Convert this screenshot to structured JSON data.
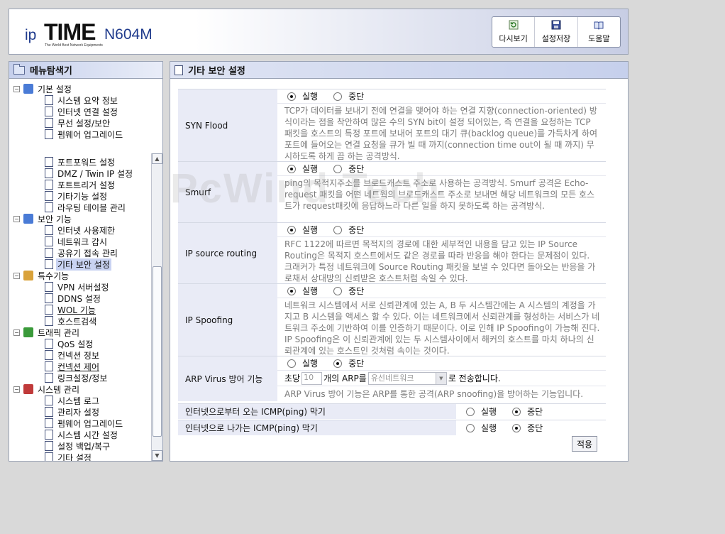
{
  "brand": {
    "ip": "ip",
    "time": "TIME",
    "model": "N604M",
    "tagline": "The World Best Network Equipments"
  },
  "toolbar": {
    "refresh_label": "다시보기",
    "save_label": "설정저장",
    "help_label": "도움말"
  },
  "menu": {
    "title": "메뉴탐색기",
    "top": [
      {
        "label": "기본 설정",
        "level": 0
      },
      {
        "label": "시스템 요약 정보",
        "level": 1
      },
      {
        "label": "인터넷 연결 설정",
        "level": 1
      },
      {
        "label": "무선 설정/보안",
        "level": 1
      },
      {
        "label": "펌웨어 업그레이드",
        "level": 1
      }
    ],
    "tree": [
      {
        "label": "포트포워드 설정",
        "level": 1
      },
      {
        "label": "DMZ / Twin IP 설정",
        "level": 1
      },
      {
        "label": "포트트리거 설정",
        "level": 1
      },
      {
        "label": "기타기능 설정",
        "level": 1
      },
      {
        "label": "라우팅 테이블 관리",
        "level": 1
      },
      {
        "label": "보안 기능",
        "level": 0
      },
      {
        "label": "인터넷 사용제한",
        "level": 1
      },
      {
        "label": "네트워크 감시",
        "level": 1
      },
      {
        "label": "공유기 접속 관리",
        "level": 1
      },
      {
        "label": "기타 보안 설정",
        "level": 1,
        "selected": true
      },
      {
        "label": "특수기능",
        "level": 0
      },
      {
        "label": "VPN 서버설정",
        "level": 1
      },
      {
        "label": "DDNS 설정",
        "level": 1
      },
      {
        "label": "WOL 기능",
        "level": 1,
        "underline": true
      },
      {
        "label": "호스트검색",
        "level": 1
      },
      {
        "label": "트래픽 관리",
        "level": 0
      },
      {
        "label": "QoS 설정",
        "level": 1
      },
      {
        "label": "컨넥션 정보",
        "level": 1
      },
      {
        "label": "컨넥션 제어",
        "level": 1,
        "underline": true
      },
      {
        "label": "링크설정/정보",
        "level": 1
      },
      {
        "label": "시스템 관리",
        "level": 0
      },
      {
        "label": "시스템 로그",
        "level": 1
      },
      {
        "label": "관리자 설정",
        "level": 1
      },
      {
        "label": "펌웨어 업그레이드",
        "level": 1
      },
      {
        "label": "시스템 시간 설정",
        "level": 1
      },
      {
        "label": "설정 백업/복구",
        "level": 1
      },
      {
        "label": "기타 설정",
        "level": 1
      }
    ]
  },
  "content": {
    "title": "기타 보안 설정",
    "radio_on": "실행",
    "radio_off": "중단",
    "sections": [
      {
        "name": "SYN Flood",
        "state": "on",
        "desc": "TCP가 데이터를 보내기 전에 연결을 맺어야 하는 연결 지향(connection-oriented) 방식이라는 점을 착안하여 많은 수의 SYN bit이 설정 되어있는, 즉 연결을 요청하는 TCP 패킷을 호스트의 특정 포트에 보내어 포트의 대기 큐(backlog queue)를 가득차게 하여 포트에 들어오는 연결 요청을 큐가 빌 때 까지(connection time out이 될 때 까지) 무시하도록 하게 끔 하는 공격방식."
      },
      {
        "name": "Smurf",
        "state": "on",
        "desc": "ping의 목적지주소를 브로드캐스트 주소로 사용하는 공격방식. Smurf 공격은 Echo-request 패킷을 어떤 네트웍의 브로드캐스트 주소로 보내면 해당 네트워크의 모든 호스트가 request패킷에 응답하느라 다른 일을 하지 못하도록 하는 공격방식."
      },
      {
        "name": "IP source routing",
        "state": "on",
        "desc": "RFC 1122에 따르면 목적지의 경로에 대한 세부적인 내용을 담고 있는 IP Source Routing은 목적지 호스트에서도 같은 경로를 따라 반응을 해야 한다는 문제점이 있다. 크래커가 특정 네트워크에 Source Routing 패킷을 보낼 수 있다면 돌아오는 반응을 가로채서 상대방의 신뢰받은 호스트처럼 속일 수 있다."
      },
      {
        "name": "IP Spoofing",
        "state": "on",
        "desc": "네트워크 시스템에서 서로 신뢰관계에 있는 A, B 두 시스템간에는 A 시스템의 계정을 가지고 B 시스템을 액세스 할 수 있다. 이는 네트워크에서 신뢰관계를 형성하는 서비스가 네트워크 주소에 기반하여 이를 인증하기 때문이다. 이로 인해 IP Spoofing이 가능해 진다. IP Spoofing은 이 신뢰관계에 있는 두 시스템사이에서 해커의 호스트를 마치 하나의 신뢰관계에 있는 호스트인 것처럼 속이는 것이다."
      }
    ],
    "arp": {
      "name": "ARP Virus 방어 기능",
      "state": "off",
      "prefix": "초당",
      "count": "10",
      "middle": "개의 ARP를",
      "select_value": "유선네트워크",
      "suffix": "로 전송합니다.",
      "desc": "ARP Virus 방어 기능은 ARP를 통한 공격(ARP snoofing)을 방어하는 기능입니다."
    },
    "icmp_in": {
      "label": "인터넷으로부터 오는 ICMP(ping) 막기",
      "state": "off"
    },
    "icmp_out": {
      "label": "인터넷으로 나가는 ICMP(ping) 막기",
      "state": "off"
    },
    "apply_label": "적용"
  },
  "watermark": "PcWind Tech"
}
